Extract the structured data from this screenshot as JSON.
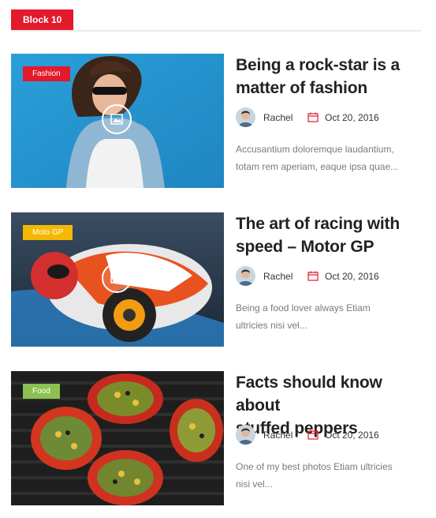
{
  "block": {
    "title": "Block 10"
  },
  "colors": {
    "accent": "#e3192c",
    "fashion": "#e3192c",
    "motogp": "#f5b800",
    "food": "#8cc152"
  },
  "posts": [
    {
      "category": "Fashion",
      "title_line1": "Being a rock-star is a",
      "title_line2": "matter of fashion",
      "author": "Rachel",
      "date": "Oct 20, 2016",
      "excerpt_line1": "Accusantium doloremque laudantium,",
      "excerpt_line2": "totam rem aperiam, eaque ipsa quae...",
      "media_icon": "image-icon"
    },
    {
      "category": "Moto GP",
      "title_line1": "The art of racing with",
      "title_line2": "speed – Motor GP",
      "author": "Rachel",
      "date": "Oct 20, 2016",
      "excerpt_line1": "Being a food lover always Etiam",
      "excerpt_line2": "ultricies nisi vel...",
      "media_icon": "image-icon"
    },
    {
      "category": "Food",
      "title_line1": "Facts should know about",
      "title_line2": "stuffed peppers",
      "author": "Rachel",
      "date": "Oct 20, 2016",
      "excerpt_line1": "One of my best photos Etiam ultricies",
      "excerpt_line2": "nisi vel..."
    }
  ]
}
